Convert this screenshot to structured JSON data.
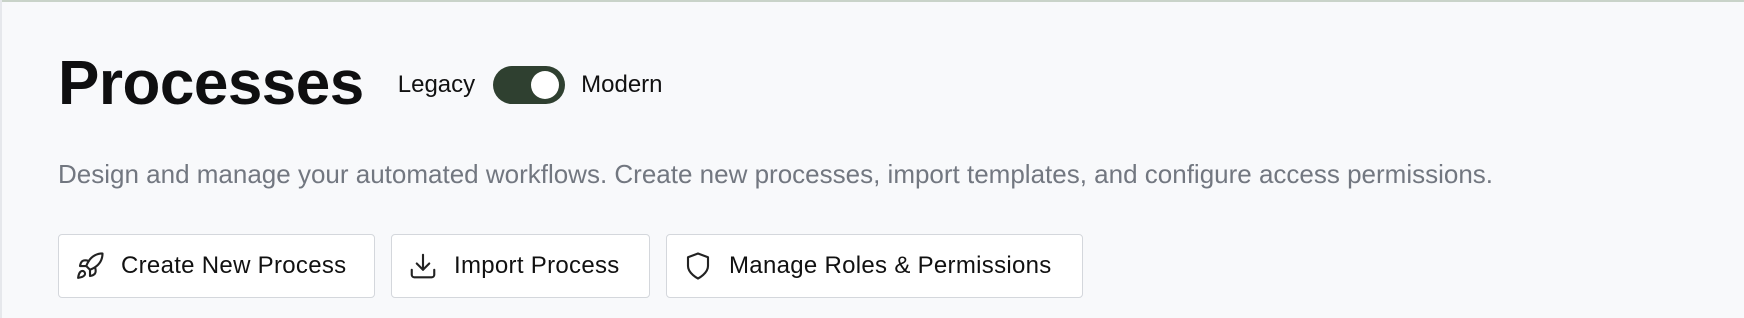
{
  "header": {
    "title": "Processes",
    "toggle": {
      "left_label": "Legacy",
      "right_label": "Modern",
      "state": "Modern",
      "accent_color": "#2f4030"
    },
    "description": "Design and manage your automated workflows. Create new processes, import templates, and configure access permissions."
  },
  "actions": [
    {
      "label": "Create New Process",
      "icon": "rocket-icon"
    },
    {
      "label": "Import Process",
      "icon": "download-icon"
    },
    {
      "label": "Manage Roles & Permissions",
      "icon": "shield-icon"
    }
  ]
}
